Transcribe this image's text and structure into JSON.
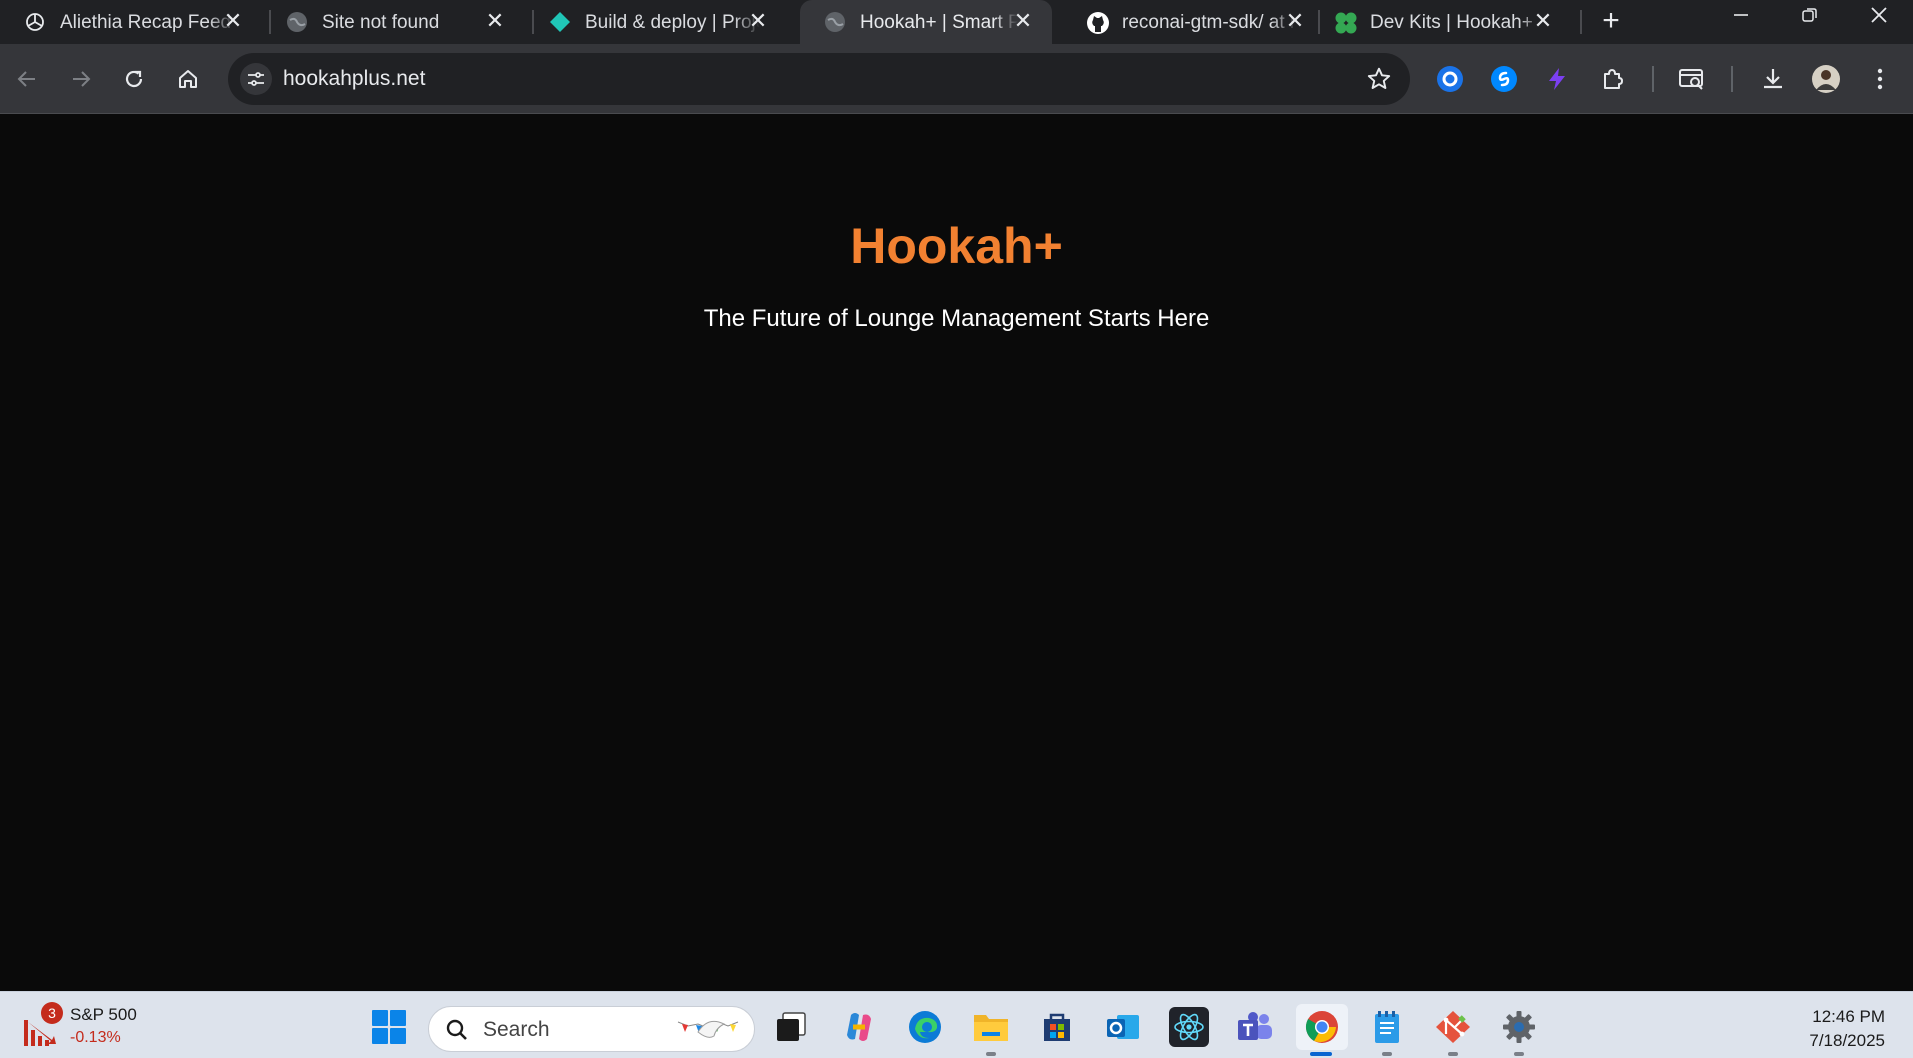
{
  "browser": {
    "tabs": [
      {
        "title": "Aliethia Recap Feed",
        "favicon": "openai-icon"
      },
      {
        "title": "Site not found",
        "favicon": "globe-icon"
      },
      {
        "title": "Build & deploy | Project",
        "favicon": "netlify-icon"
      },
      {
        "title": "Hookah+ | Smart POS",
        "favicon": "globe-icon",
        "active": true
      },
      {
        "title": "reconai-gtm-sdk/ at main",
        "favicon": "github-icon"
      },
      {
        "title": "Dev Kits | Hookah+",
        "favicon": "clover-icon"
      }
    ],
    "new_tab": "+",
    "url": "hookahplus.net"
  },
  "page": {
    "title": "Hookah+",
    "subtitle": "The Future of Lounge Management Starts Here",
    "accent": "#f28131",
    "background": "#0a0a0a"
  },
  "taskbar": {
    "widget": {
      "name": "S&P 500",
      "change": "-0.13%",
      "badge": "3"
    },
    "search_placeholder": "Search",
    "apps": [
      "windows-start-icon",
      "task-view-icon",
      "copilot-icon",
      "edge-icon",
      "file-explorer-icon",
      "store-icon",
      "outlook-icon",
      "react-icon",
      "teams-icon",
      "chrome-icon",
      "notepad-icon",
      "git-icon",
      "settings-icon"
    ],
    "time": "12:46 PM",
    "date": "7/18/2025"
  }
}
